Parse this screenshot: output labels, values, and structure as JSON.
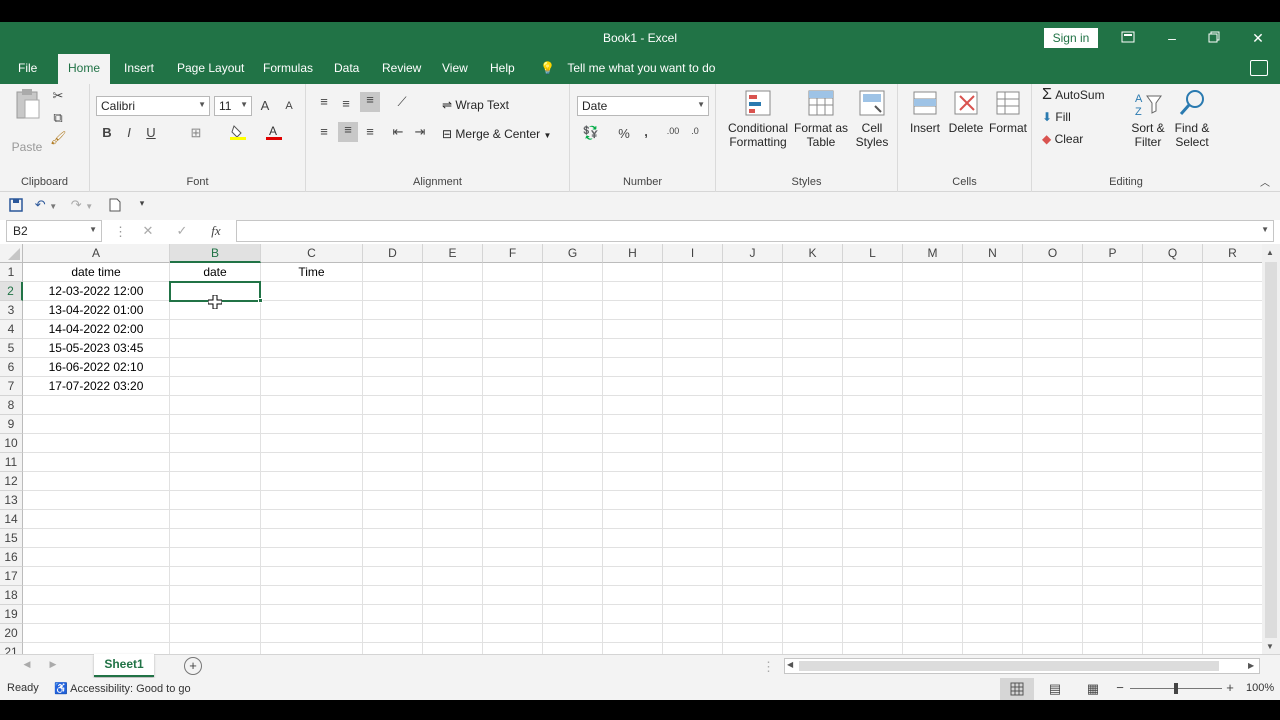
{
  "window": {
    "title": "Book1  -  Excel",
    "sign_in": "Sign in"
  },
  "tabs": [
    "File",
    "Home",
    "Insert",
    "Page Layout",
    "Formulas",
    "Data",
    "Review",
    "View",
    "Help"
  ],
  "active_tab": "Home",
  "tell_me": "Tell me what you want to do",
  "ribbon": {
    "clipboard": {
      "label": "Clipboard",
      "paste": "Paste"
    },
    "font": {
      "label": "Font",
      "name": "Calibri",
      "size": "11",
      "bold": "B",
      "italic": "I",
      "underline": "U"
    },
    "alignment": {
      "label": "Alignment",
      "wrap_text": "Wrap Text",
      "merge_center": "Merge & Center"
    },
    "number": {
      "label": "Number",
      "format": "Date",
      "percent": "%",
      "comma": ","
    },
    "styles": {
      "label": "Styles",
      "conditional_1": "Conditional",
      "conditional_2": "Formatting",
      "format_table_1": "Format as",
      "format_table_2": "Table",
      "cell_styles_1": "Cell",
      "cell_styles_2": "Styles"
    },
    "cells": {
      "label": "Cells",
      "insert": "Insert",
      "delete": "Delete",
      "format": "Format"
    },
    "editing": {
      "label": "Editing",
      "autosum": "AutoSum",
      "fill": "Fill",
      "clear": "Clear",
      "sort_1": "Sort &",
      "sort_2": "Filter",
      "find_1": "Find &",
      "find_2": "Select"
    }
  },
  "formula_bar": {
    "name_box": "B2",
    "fx": "fx",
    "content": ""
  },
  "columns": [
    "A",
    "B",
    "C",
    "D",
    "E",
    "F",
    "G",
    "H",
    "I",
    "J",
    "K",
    "L",
    "M",
    "N",
    "O",
    "P",
    "Q",
    "R"
  ],
  "rows": [
    "1",
    "2",
    "3",
    "4",
    "5",
    "6",
    "7",
    "8",
    "9",
    "10",
    "11",
    "12",
    "13",
    "14",
    "15",
    "16",
    "17",
    "18",
    "19",
    "20",
    "21"
  ],
  "cells": {
    "A1": "date time",
    "B1": "date",
    "C1": "Time",
    "A2": "12-03-2022 12:00",
    "A3": "13-04-2022 01:00",
    "A4": "14-04-2022 02:00",
    "A5": "15-05-2023 03:45",
    "A6": "16-06-2022 02:10",
    "A7": "17-07-2022 03:20"
  },
  "selected_cell": "B2",
  "sheets": [
    "Sheet1"
  ],
  "status": {
    "ready": "Ready",
    "accessibility": "Accessibility: Good to go",
    "zoom": "100%"
  },
  "colors": {
    "excel_green": "#217346"
  }
}
